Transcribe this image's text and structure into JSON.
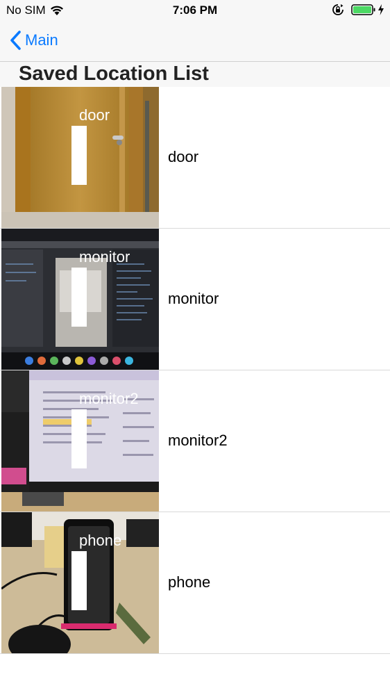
{
  "status": {
    "carrier": "No SIM",
    "time": "7:06 PM"
  },
  "nav": {
    "back_label": "Main"
  },
  "section": {
    "title": "Saved Location List"
  },
  "locations": [
    {
      "name": "door",
      "marker_label": "door"
    },
    {
      "name": "monitor",
      "marker_label": "monitor"
    },
    {
      "name": "monitor2",
      "marker_label": "monitor2"
    },
    {
      "name": "phone",
      "marker_label": "phone"
    }
  ],
  "colors": {
    "accent": "#0a7aff",
    "battery": "#4cd964",
    "bar_background": "#f7f7f7"
  },
  "icons": {
    "wifi": "wifi-icon",
    "orientation_lock": "orientation-lock-icon",
    "battery": "battery-icon",
    "charging": "charging-bolt-icon",
    "back": "chevron-left-icon"
  }
}
